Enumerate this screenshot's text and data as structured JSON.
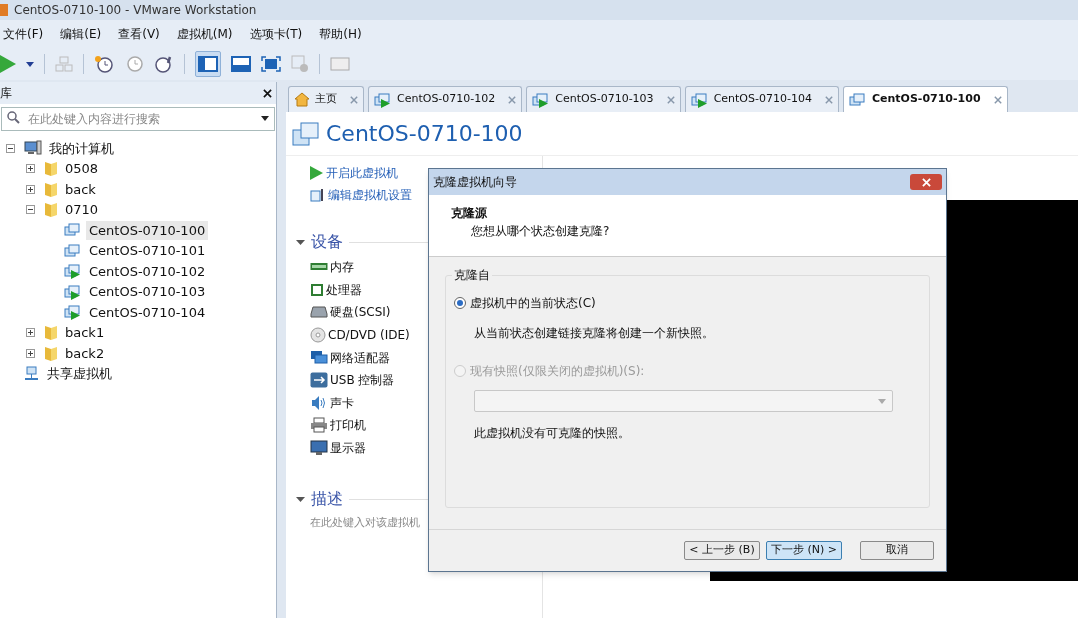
{
  "window": {
    "title": "CentOS-0710-100 - VMware Workstation"
  },
  "menu": [
    "文件(F)",
    "编辑(E)",
    "查看(V)",
    "虚拟机(M)",
    "选项卡(T)",
    "帮助(H)"
  ],
  "library": {
    "title": "库",
    "search": {
      "placeholder": "在此处键入内容进行搜索"
    },
    "tree": [
      {
        "label": "我的计算机",
        "kind": "computer",
        "expanded": true,
        "children": [
          {
            "label": "0508",
            "kind": "folder",
            "expanded": false
          },
          {
            "label": "back",
            "kind": "folder",
            "expanded": false
          },
          {
            "label": "0710",
            "kind": "folder",
            "expanded": true,
            "children": [
              {
                "label": "CentOS-0710-100",
                "kind": "vm",
                "running": false,
                "selected": true
              },
              {
                "label": "CentOS-0710-101",
                "kind": "vm",
                "running": false,
                "selected": false
              },
              {
                "label": "CentOS-0710-102",
                "kind": "vm",
                "running": true,
                "selected": false
              },
              {
                "label": "CentOS-0710-103",
                "kind": "vm",
                "running": true,
                "selected": false
              },
              {
                "label": "CentOS-0710-104",
                "kind": "vm",
                "running": true,
                "selected": false
              }
            ]
          },
          {
            "label": "back1",
            "kind": "folder",
            "expanded": false
          },
          {
            "label": "back2",
            "kind": "folder",
            "expanded": false
          }
        ]
      },
      {
        "label": "共享虚拟机",
        "kind": "shared"
      }
    ]
  },
  "tabs": [
    {
      "label": "主页",
      "kind": "home",
      "selected": false
    },
    {
      "label": "CentOS-0710-102",
      "kind": "vm",
      "running": true,
      "selected": false
    },
    {
      "label": "CentOS-0710-103",
      "kind": "vm",
      "running": true,
      "selected": false
    },
    {
      "label": "CentOS-0710-104",
      "kind": "vm",
      "running": true,
      "selected": false
    },
    {
      "label": "CentOS-0710-100",
      "kind": "vm",
      "running": false,
      "selected": true
    }
  ],
  "vm_page": {
    "title": "CentOS-0710-100",
    "actions": [
      {
        "label": "开启此虚拟机",
        "kind": "play"
      },
      {
        "label": "编辑虚拟机设置",
        "kind": "settings"
      }
    ],
    "devices": {
      "title": "设备",
      "expanded": true,
      "items": [
        {
          "label": "内存",
          "kind": "memory"
        },
        {
          "label": "处理器",
          "kind": "cpu"
        },
        {
          "label": "硬盘(SCSI)",
          "kind": "disk"
        },
        {
          "label": "CD/DVD (IDE)",
          "kind": "cd"
        },
        {
          "label": "网络适配器",
          "kind": "network"
        },
        {
          "label": "USB 控制器",
          "kind": "usb"
        },
        {
          "label": "声卡",
          "kind": "sound"
        },
        {
          "label": "打印机",
          "kind": "printer"
        },
        {
          "label": "显示器",
          "kind": "display"
        }
      ]
    },
    "description": {
      "title": "描述",
      "expanded": true,
      "placeholder": "在此处键入对该虚拟机"
    }
  },
  "dialog": {
    "title": "克隆虚拟机向导",
    "heading": "克隆源",
    "subheading": "您想从哪个状态创建克隆?",
    "group": "克隆自",
    "options": [
      {
        "label": "虚拟机中的当前状态(C)",
        "kind": "plain",
        "selected": true,
        "disabled": false,
        "note": "从当前状态创建链接克隆将创建一个新快照。"
      },
      {
        "label": "现有快照(仅限关闭的虚拟机)(S):",
        "kind": "snapshot",
        "selected": false,
        "disabled": true,
        "note": "此虚拟机没有可克隆的快照。"
      }
    ],
    "buttons": [
      {
        "label": "< 上一步 (B)",
        "default": false
      },
      {
        "label": "下一步 (N) >",
        "default": true
      },
      {
        "label": "取消",
        "default": false
      }
    ]
  }
}
